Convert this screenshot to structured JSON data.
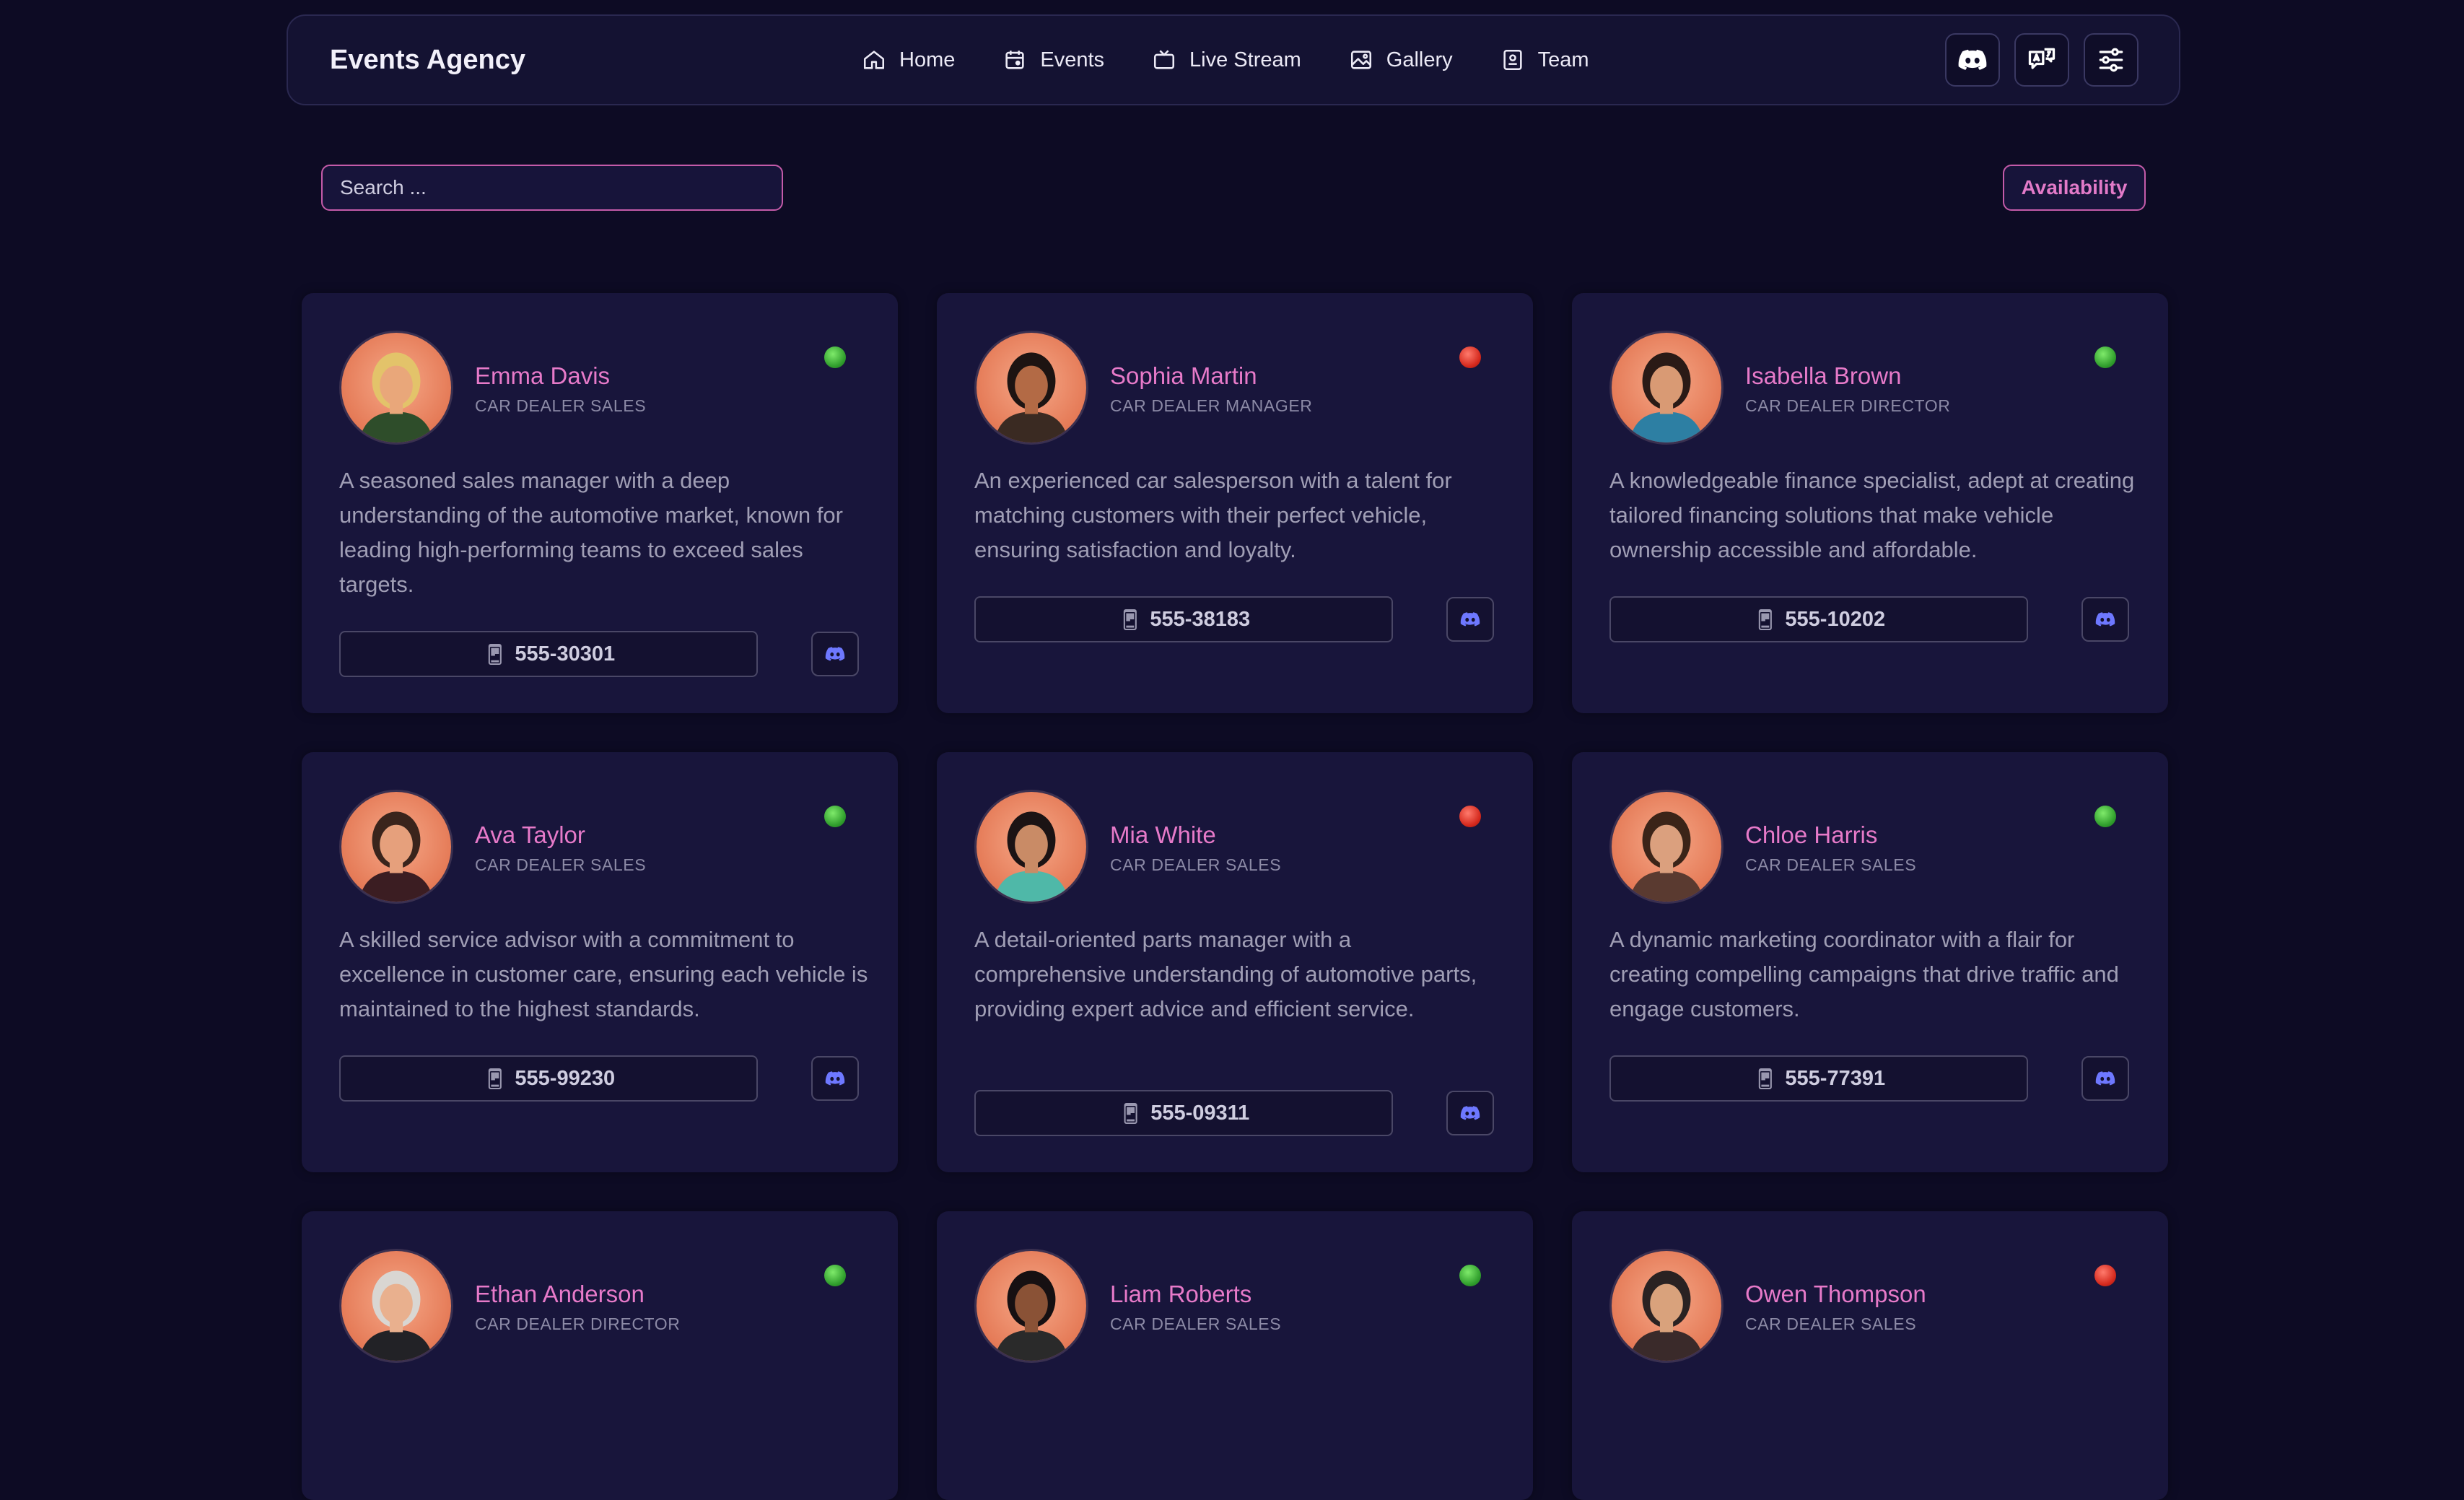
{
  "brand": "Events Agency",
  "nav": [
    {
      "label": "Home",
      "icon": "home-icon"
    },
    {
      "label": "Events",
      "icon": "calendar-icon"
    },
    {
      "label": "Live Stream",
      "icon": "tv-icon"
    },
    {
      "label": "Gallery",
      "icon": "image-icon"
    },
    {
      "label": "Team",
      "icon": "id-card-icon"
    }
  ],
  "actions": [
    "discord-icon",
    "translate-icon",
    "sliders-icon"
  ],
  "search": {
    "placeholder": "Search ..."
  },
  "availability_label": "Availability",
  "colors": {
    "accent": "#e77ac9",
    "available": "#3fbf3a",
    "unavailable": "#e0302a",
    "discord": "#6e78ff"
  },
  "team": [
    {
      "name": "Emma Davis",
      "role": "CAR DEALER SALES",
      "status": "available",
      "description": "A seasoned sales manager with a deep understanding of the automotive market, known for leading high-performing teams to exceed sales targets.",
      "phone": "555-30301"
    },
    {
      "name": "Sophia Martin",
      "role": "CAR DEALER MANAGER",
      "status": "unavailable",
      "description": "An experienced car salesperson with a talent for matching customers with their perfect vehicle, ensuring satisfaction and loyalty.",
      "phone": "555-38183"
    },
    {
      "name": "Isabella Brown",
      "role": "CAR DEALER DIRECTOR",
      "status": "available",
      "description": "A knowledgeable finance specialist, adept at creating tailored financing solutions that make vehicle ownership accessible and affordable.",
      "phone": "555-10202"
    },
    {
      "name": "Ava Taylor",
      "role": "CAR DEALER SALES",
      "status": "available",
      "description": "A skilled service advisor with a commitment to excellence in customer care, ensuring each vehicle is maintained to the highest standards.",
      "phone": "555-99230"
    },
    {
      "name": "Mia White",
      "role": "CAR DEALER SALES",
      "status": "unavailable",
      "description": "A detail-oriented parts manager with a comprehensive understanding of automotive parts, providing expert advice and efficient service.",
      "phone": "555-09311"
    },
    {
      "name": "Chloe Harris",
      "role": "CAR DEALER SALES",
      "status": "available",
      "description": "A dynamic marketing coordinator with a flair for creating compelling campaigns that drive traffic and engage customers.",
      "phone": "555-77391"
    },
    {
      "name": "Ethan Anderson",
      "role": "CAR DEALER DIRECTOR",
      "status": "available"
    },
    {
      "name": "Liam Roberts",
      "role": "CAR DEALER SALES",
      "status": "available"
    },
    {
      "name": "Owen Thompson",
      "role": "CAR DEALER SALES",
      "status": "unavailable"
    }
  ]
}
